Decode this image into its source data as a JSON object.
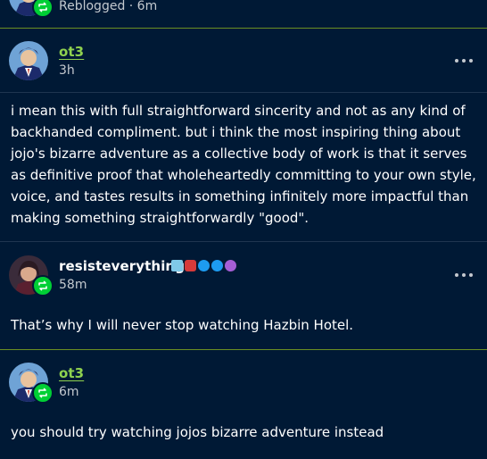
{
  "top_row": {
    "meta": "Reblogged · 6m"
  },
  "posts": [
    {
      "username": "ot3",
      "time": "3h",
      "text": "i mean this with full straightforward sincerity and not as any kind of backhanded compliment. but i think the most inspiring thing about jojo's bizarre adventure as a collective body of work is that it serves as definitive proof that wholeheartedly committing to your own style, voice, and tastes results in something infinitely more impactful than making something straightforwardly \"good\"."
    },
    {
      "username": "resisteverything",
      "time": "58m",
      "text": "That’s why I will never stop watching Hazbin Hotel."
    },
    {
      "username": "ot3",
      "time": "6m",
      "text": "you should try watching jojos bizarre adventure instead"
    }
  ],
  "colors": {
    "background": "#001935",
    "accent_green": "#8fd14f",
    "reblog_green": "#00cf35",
    "separator": "#6b8f23"
  },
  "icons": {
    "reblog": "reblog-icon",
    "more": "more-options-icon"
  }
}
